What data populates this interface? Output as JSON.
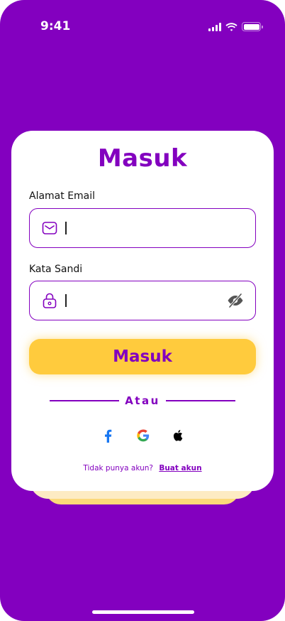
{
  "status_bar": {
    "time": "9:41",
    "icons": [
      "cellular-signal-icon",
      "wifi-icon",
      "battery-icon"
    ]
  },
  "login": {
    "title": "Masuk",
    "email": {
      "label": "Alamat Email",
      "value": "",
      "placeholder": "",
      "icon": "envelope-icon"
    },
    "password": {
      "label": "Kata Sandi",
      "value": "",
      "placeholder": "",
      "icon": "lock-icon",
      "toggle_icon": "eye-off-icon"
    },
    "submit_label": "Masuk",
    "divider_text": "Atau",
    "social": [
      {
        "name": "facebook",
        "icon": "facebook-icon"
      },
      {
        "name": "google",
        "icon": "google-icon"
      },
      {
        "name": "apple",
        "icon": "apple-icon"
      }
    ],
    "signup_prompt": "Tidak punya akun?",
    "signup_link": "Buat akun"
  },
  "colors": {
    "background": "#8300BF",
    "accent": "#8300BF",
    "button": "#FFCB3D",
    "card": "#FFFFFF"
  }
}
